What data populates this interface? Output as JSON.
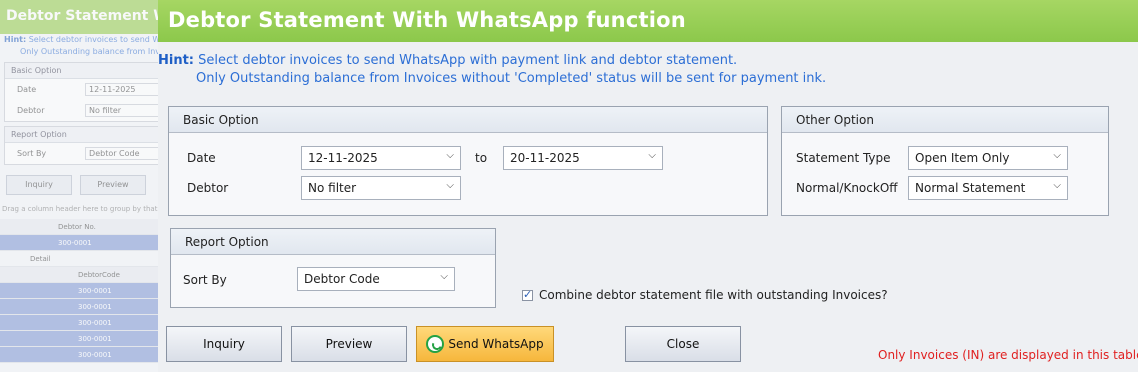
{
  "background_window": {
    "title": "Debtor Statement Wi",
    "hint_label": "Hint:",
    "hint_line1": "Select debtor invoices to send Wha",
    "hint_line2": "Only Outstanding balance from Inv",
    "basic_head": "Basic Option",
    "date_label": "Date",
    "date_value": "12-11-2025",
    "debtor_label": "Debtor",
    "debtor_value": "No filter",
    "report_head": "Report Option",
    "sortby_label": "Sort By",
    "sortby_value": "Debtor Code",
    "inquiry": "Inquiry",
    "preview": "Preview",
    "drag_text": "Drag a column header here to group by that c",
    "grid_header": "Debtor No.",
    "grid_row_value": "300-0001",
    "detail_label": "Detail",
    "detail_col": "DebtorCode",
    "detail_rows": [
      "300-0001",
      "300-0001",
      "300-0001",
      "300-0001",
      "300-0001"
    ]
  },
  "dialog": {
    "title": "Debtor Statement With WhatsApp function",
    "hint_label": "Hint:",
    "hint_line1": "Select debtor invoices to send WhatsApp with payment link and debtor statement.",
    "hint_line2": "Only Outstanding balance from Invoices without 'Completed' status will be sent for payment ink."
  },
  "basic_option": {
    "header": "Basic Option",
    "date_label": "Date",
    "date_from": "12-11-2025",
    "to_label": "to",
    "date_to": "20-11-2025",
    "debtor_label": "Debtor",
    "debtor_value": "No filter"
  },
  "other_option": {
    "header": "Other Option",
    "statement_type_label": "Statement Type",
    "statement_type_value": "Open Item Only",
    "knockoff_label": "Normal/KnockOff",
    "knockoff_value": "Normal Statement"
  },
  "report_option": {
    "header": "Report Option",
    "sort_by_label": "Sort By",
    "sort_by_value": "Debtor Code"
  },
  "combine_checkbox": {
    "checked": true,
    "label": "Combine debtor statement file with outstanding Invoices?"
  },
  "buttons": {
    "inquiry": "Inquiry",
    "preview": "Preview",
    "send_whatsapp": "Send WhatsApp",
    "close": "Close"
  },
  "footer_note": "Only Invoices (IN) are displayed in this table",
  "icons": {
    "dropdown": "chevron-down-icon",
    "whatsapp": "whatsapp-icon",
    "checkbox": "check-icon"
  },
  "colors": {
    "title_bar": "#8cc84b",
    "hint_text": "#2c6ed5",
    "whatsapp_button": "#f6b73c",
    "note_text": "#e02020"
  }
}
